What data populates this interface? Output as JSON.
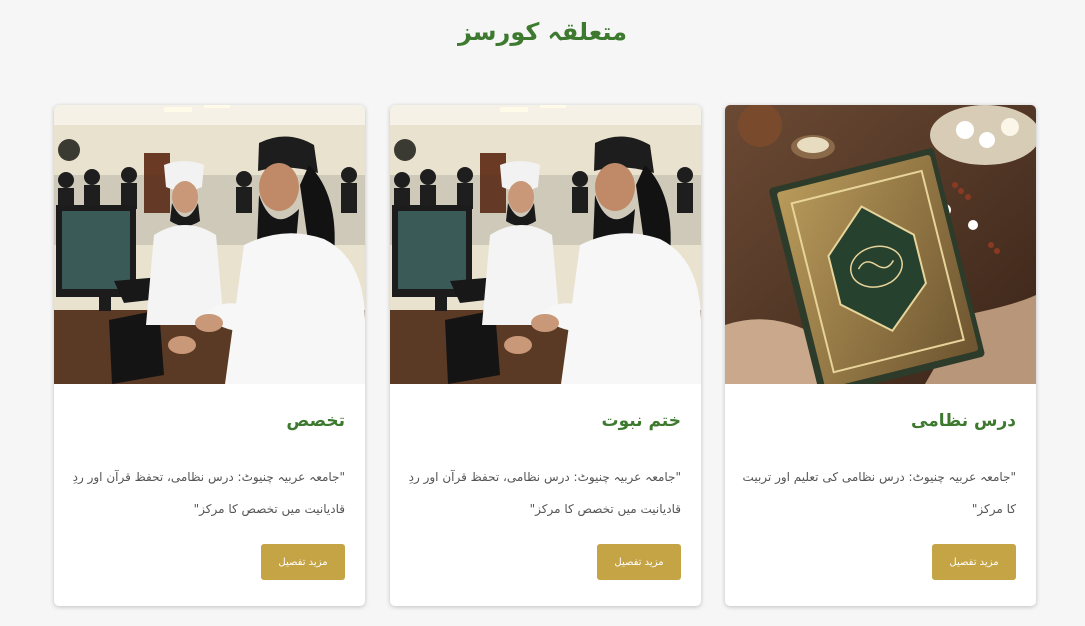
{
  "section": {
    "title": "متعلقہ کورسز"
  },
  "courses": [
    {
      "title": "درس نظامی",
      "description": "\"جامعہ عربیہ چنیوٹ: درس نظامی کی تعلیم اور تربیت کا مرکز\"",
      "button_label": "مزید تفصیل",
      "image": "quran-book-image"
    },
    {
      "title": "ختم نبوت",
      "description": "\"جامعہ عربیہ چنیوٹ: درس نظامی، تحفظ قرآن اور ردِ قادیانیت میں تخصص کا مرکز\"",
      "button_label": "مزید تفصیل",
      "image": "students-computer-lab-image"
    },
    {
      "title": "تخصص",
      "description": "\"جامعہ عربیہ چنیوٹ: درس نظامی، تحفظ قرآن اور ردِ قادیانیت میں تخصص کا مرکز\"",
      "button_label": "مزید تفصیل",
      "image": "students-computer-lab-image"
    }
  ],
  "colors": {
    "title_green": "#3d7a30",
    "button_gold": "#c4a444",
    "text_gray": "#555555"
  }
}
